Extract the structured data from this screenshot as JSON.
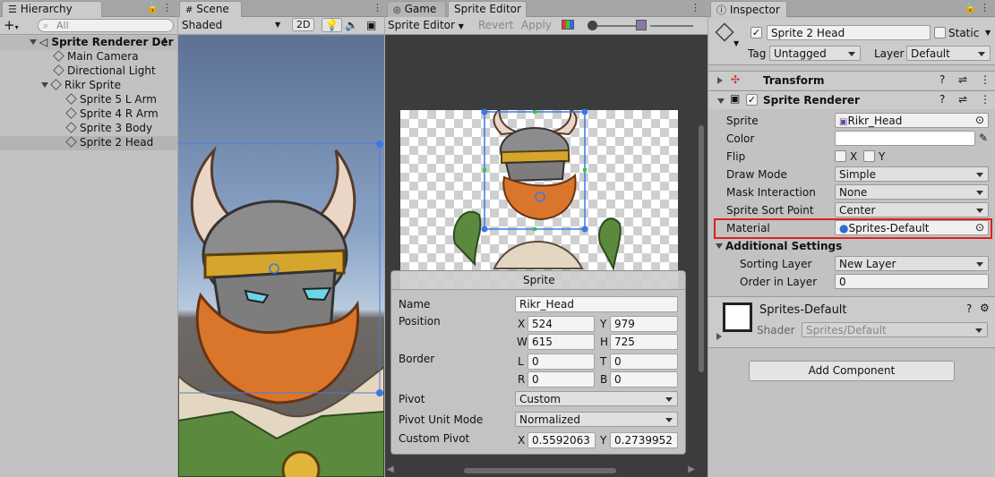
{
  "hierarchy": {
    "tab_label": "Hierarchy",
    "search_placeholder": "All",
    "add_label": "+",
    "items": [
      {
        "label": "Sprite Renderer Der"
      },
      {
        "label": "Main Camera"
      },
      {
        "label": "Directional Light"
      },
      {
        "label": "Rikr Sprite"
      },
      {
        "label": "Sprite 5 L Arm"
      },
      {
        "label": "Sprite 4 R Arm"
      },
      {
        "label": "Sprite 3 Body"
      },
      {
        "label": "Sprite 2 Head"
      }
    ]
  },
  "scene": {
    "tab_label": "Scene",
    "shading_mode": "Shaded",
    "mode_2d": "2D"
  },
  "sprite_editor": {
    "game_tab_label": "Game",
    "tab_label": "Sprite Editor",
    "mode_dropdown": "Sprite Editor",
    "revert_label": "Revert",
    "apply_label": "Apply",
    "sprite_panel": {
      "title": "Sprite",
      "name_label": "Name",
      "name_value": "Rikr_Head",
      "position_label": "Position",
      "x_label": "X",
      "x_value": "524",
      "y_label": "Y",
      "y_value": "979",
      "w_label": "W",
      "w_value": "615",
      "h_label": "H",
      "h_value": "725",
      "border_label": "Border",
      "l_label": "L",
      "l_value": "0",
      "t_label": "T",
      "t_value": "0",
      "r_label": "R",
      "r_value": "0",
      "b_label": "B",
      "b_value": "0",
      "pivot_label": "Pivot",
      "pivot_value": "Custom",
      "pivot_unit_label": "Pivot Unit Mode",
      "pivot_unit_value": "Normalized",
      "custom_pivot_label": "Custom Pivot",
      "cp_x_label": "X",
      "cp_x_value": "0.5592063",
      "cp_y_label": "Y",
      "cp_y_value": "0.2739952"
    }
  },
  "inspector": {
    "tab_label": "Inspector",
    "object_name": "Sprite 2 Head",
    "static_label": "Static",
    "tag_label": "Tag",
    "tag_value": "Untagged",
    "layer_label": "Layer",
    "layer_value": "Default",
    "transform_label": "Transform",
    "sprite_renderer_label": "Sprite Renderer",
    "props": {
      "sprite_label": "Sprite",
      "sprite_value": "Rikr_Head",
      "color_label": "Color",
      "flip_label": "Flip",
      "flip_x": "X",
      "flip_y": "Y",
      "draw_mode_label": "Draw Mode",
      "draw_mode_value": "Simple",
      "mask_label": "Mask Interaction",
      "mask_value": "None",
      "sort_point_label": "Sprite Sort Point",
      "sort_point_value": "Center",
      "material_label": "Material",
      "material_value": "Sprites-Default",
      "additional_label": "Additional Settings",
      "sorting_layer_label": "Sorting Layer",
      "sorting_layer_value": "New Layer",
      "order_label": "Order in Layer",
      "order_value": "0"
    },
    "material_name": "Sprites-Default",
    "shader_label": "Shader",
    "shader_value": "Sprites/Default",
    "add_component_label": "Add Component",
    "highlight_color": "#e02020"
  }
}
